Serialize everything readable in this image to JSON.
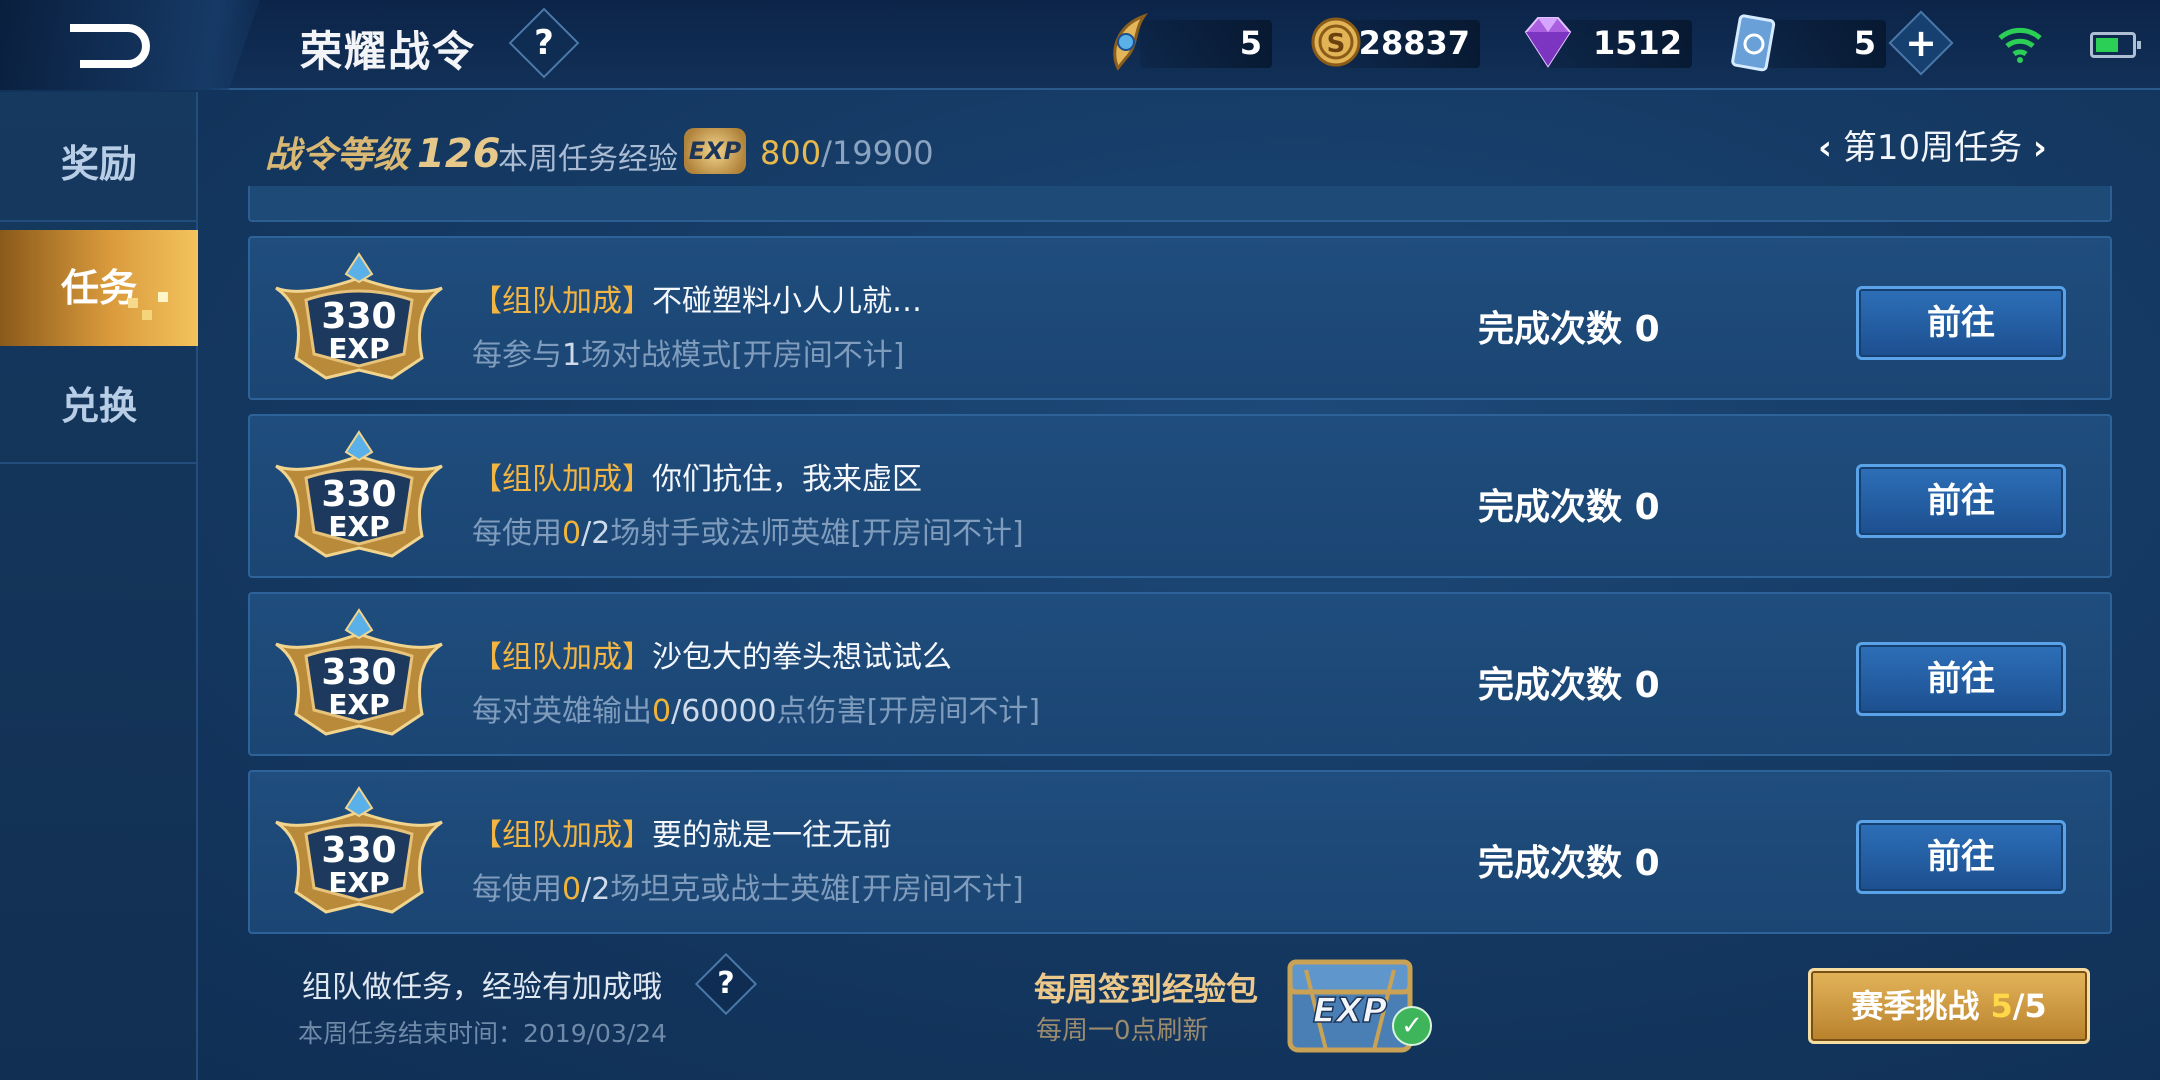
{
  "header": {
    "title": "荣耀战令",
    "help": "?",
    "resources": [
      {
        "icon": "quill-token-icon",
        "value": "5"
      },
      {
        "icon": "gold-coin-icon",
        "value": "28837"
      },
      {
        "icon": "diamond-icon",
        "value": "1512"
      },
      {
        "icon": "card-ticket-icon",
        "value": "5"
      }
    ]
  },
  "sidebar": {
    "items": [
      {
        "label": "奖励",
        "active": false
      },
      {
        "label": "任务",
        "active": true
      },
      {
        "label": "兑换",
        "active": false
      }
    ]
  },
  "summary": {
    "level_label": "战令等级",
    "level_value": "126",
    "weekly_exp_label": "本周任务经验",
    "exp_badge": "EXP",
    "exp_current": "800",
    "exp_separator": "/",
    "exp_total": "19900",
    "week_label": "第10周任务"
  },
  "tasks": [
    {
      "exp": "330",
      "exp_unit": "EXP",
      "tag": "【组队加成】",
      "title": "不碰塑料小人儿就…",
      "desc_prefix": "每参与",
      "desc_progress": "",
      "desc_total": "1",
      "desc_suffix": "场对战模式[开房间不计]",
      "count_label": "完成次数",
      "count_value": "0",
      "button": "前往"
    },
    {
      "exp": "330",
      "exp_unit": "EXP",
      "tag": "【组队加成】",
      "title": "你们抗住，我来虚区",
      "desc_prefix": "每使用",
      "desc_progress": "0",
      "desc_total": "/2",
      "desc_suffix": "场射手或法师英雄[开房间不计]",
      "count_label": "完成次数",
      "count_value": "0",
      "button": "前往"
    },
    {
      "exp": "330",
      "exp_unit": "EXP",
      "tag": "【组队加成】",
      "title": "沙包大的拳头想试试么",
      "desc_prefix": "每对英雄输出",
      "desc_progress": "0",
      "desc_total": "/60000",
      "desc_suffix": "点伤害[开房间不计]",
      "count_label": "完成次数",
      "count_value": "0",
      "button": "前往"
    },
    {
      "exp": "330",
      "exp_unit": "EXP",
      "tag": "【组队加成】",
      "title": "要的就是一往无前",
      "desc_prefix": "每使用",
      "desc_progress": "0",
      "desc_total": "/2",
      "desc_suffix": "场坦克或战士英雄[开房间不计]",
      "count_label": "完成次数",
      "count_value": "0",
      "button": "前往"
    }
  ],
  "footer": {
    "tip": "组队做任务，经验有加成哦",
    "help": "?",
    "end_time": "本周任务结束时间：2019/03/24",
    "pack_title": "每周签到经验包",
    "pack_sub": "每周一0点刷新",
    "pack_badge": "EXP",
    "season_label": "赛季挑战 ",
    "season_progress": "5",
    "season_total": "/5"
  },
  "colors": {
    "accent_gold": "#e9b84a",
    "button_blue": "#2d6fb8",
    "active_tab": "#d99a3c"
  }
}
